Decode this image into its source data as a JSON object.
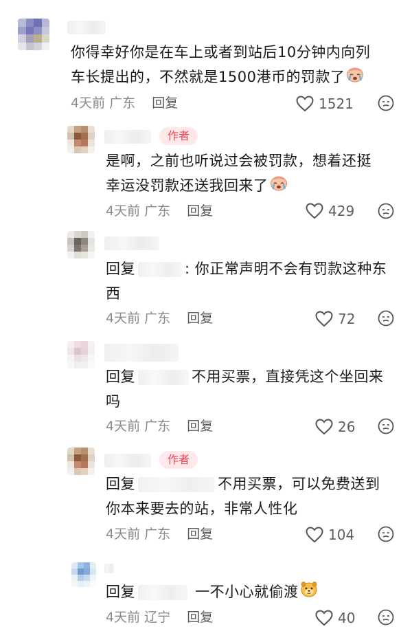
{
  "comments": [
    {
      "text_line1": "你得幸好你是在车上或者到站后10分钟内向列",
      "text_line2": "车长提出的，不然就是1500港币的罚款了",
      "time": "4天前",
      "location": "广东",
      "reply_label": "回复",
      "likes": "1521",
      "emoji_icon": "crying-face-icon"
    },
    {
      "author_badge": "作者",
      "text_line1": "是啊，之前也听说过会被罚款，想着还挺",
      "text_line2": "幸运没罚款还送我回来了",
      "time": "4天前",
      "location": "广东",
      "reply_label": "回复",
      "likes": "429",
      "emoji_icon": "crying-face-icon"
    },
    {
      "reply_prefix": "回复",
      "text_line1": ": 你正常声明不会有罚款这种东",
      "text_line2": "西",
      "time": "4天前",
      "location": "广东",
      "reply_label": "回复",
      "likes": "72"
    },
    {
      "reply_prefix": "回复",
      "text_line1": "不用买票，直接凭这个坐回来",
      "text_line2": "吗",
      "time": "4天前",
      "location": "广东",
      "reply_label": "回复",
      "likes": "26"
    },
    {
      "author_badge": "作者",
      "reply_prefix": "回复",
      "text_line1": "不用买票，可以免费送到",
      "text_line2": "你本来要去的站，非常人性化",
      "time": "4天前",
      "location": "广东",
      "reply_label": "回复",
      "likes": "104"
    },
    {
      "reply_prefix": "回复",
      "text_line1": "一不小心就偷渡",
      "time": "4天前",
      "location": "辽宁",
      "reply_label": "回复",
      "likes": "40",
      "emoji_icon": "dog-face-icon"
    }
  ]
}
